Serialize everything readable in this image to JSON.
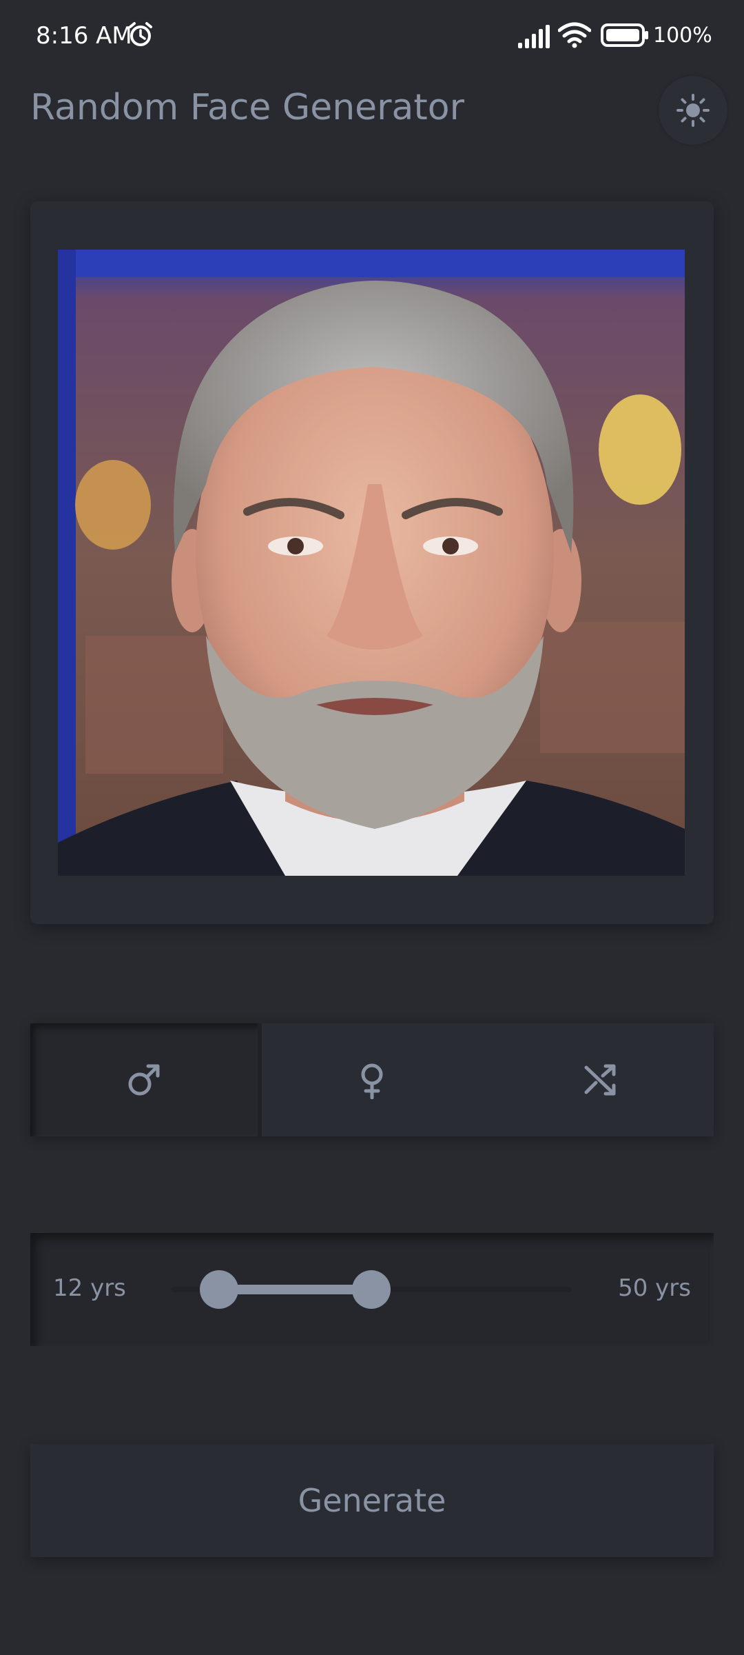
{
  "status_bar": {
    "time": "8:16 AM",
    "battery": "100%",
    "icons": [
      "alarm-icon",
      "signal-icon",
      "wifi-icon",
      "battery-icon"
    ]
  },
  "header": {
    "title": "Random Face Generator",
    "theme_icon": "sun-icon"
  },
  "image": {
    "description_icon": "face-photo"
  },
  "gender": {
    "options": [
      {
        "icon": "male-icon",
        "selected": true
      },
      {
        "icon": "female-icon",
        "selected": false
      },
      {
        "icon": "shuffle-icon",
        "selected": false
      }
    ]
  },
  "age": {
    "min_label": "12 yrs",
    "max_label": "50 yrs",
    "range_low_fraction": 0.12,
    "range_high_fraction": 0.5
  },
  "actions": {
    "generate_label": "Generate"
  },
  "colors": {
    "background": "#282a30",
    "accent": "#8a93a3"
  }
}
